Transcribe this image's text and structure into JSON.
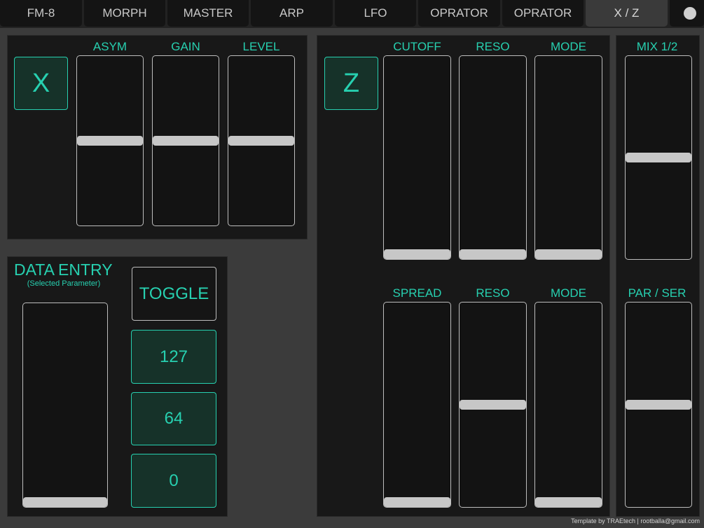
{
  "tabs": [
    {
      "label": "FM-8"
    },
    {
      "label": "MORPH"
    },
    {
      "label": "MASTER"
    },
    {
      "label": "ARP"
    },
    {
      "label": "LFO"
    },
    {
      "label": "OPRATOR"
    },
    {
      "label": "OPRATOR"
    },
    {
      "label": "X / Z",
      "active": true
    }
  ],
  "x_section": {
    "button_label": "X",
    "faders": [
      {
        "label": "ASYM",
        "value": 0.5
      },
      {
        "label": "GAIN",
        "value": 0.5
      },
      {
        "label": "LEVEL",
        "value": 0.5
      }
    ]
  },
  "z_section": {
    "button_label": "Z",
    "top_faders": [
      {
        "label": "CUTOFF",
        "value": 0
      },
      {
        "label": "RESO",
        "value": 0
      },
      {
        "label": "MODE",
        "value": 0
      }
    ],
    "bottom_faders": [
      {
        "label": "SPREAD",
        "value": 0
      },
      {
        "label": "RESO",
        "value": 0.5
      },
      {
        "label": "MODE",
        "value": 0
      }
    ]
  },
  "mix_section": {
    "faders": [
      {
        "label": "MIX 1/2",
        "value": 0.5
      },
      {
        "label": "PAR / SER",
        "value": 0.5
      }
    ]
  },
  "data_entry": {
    "title": "DATA ENTRY",
    "subtitle": "(Selected Parameter)",
    "fader_value": 0,
    "toggle_label": "TOGGLE",
    "value_buttons": [
      "127",
      "64",
      "0"
    ]
  },
  "footer": "Template by TRAEtech | rootballa@gmail.com"
}
